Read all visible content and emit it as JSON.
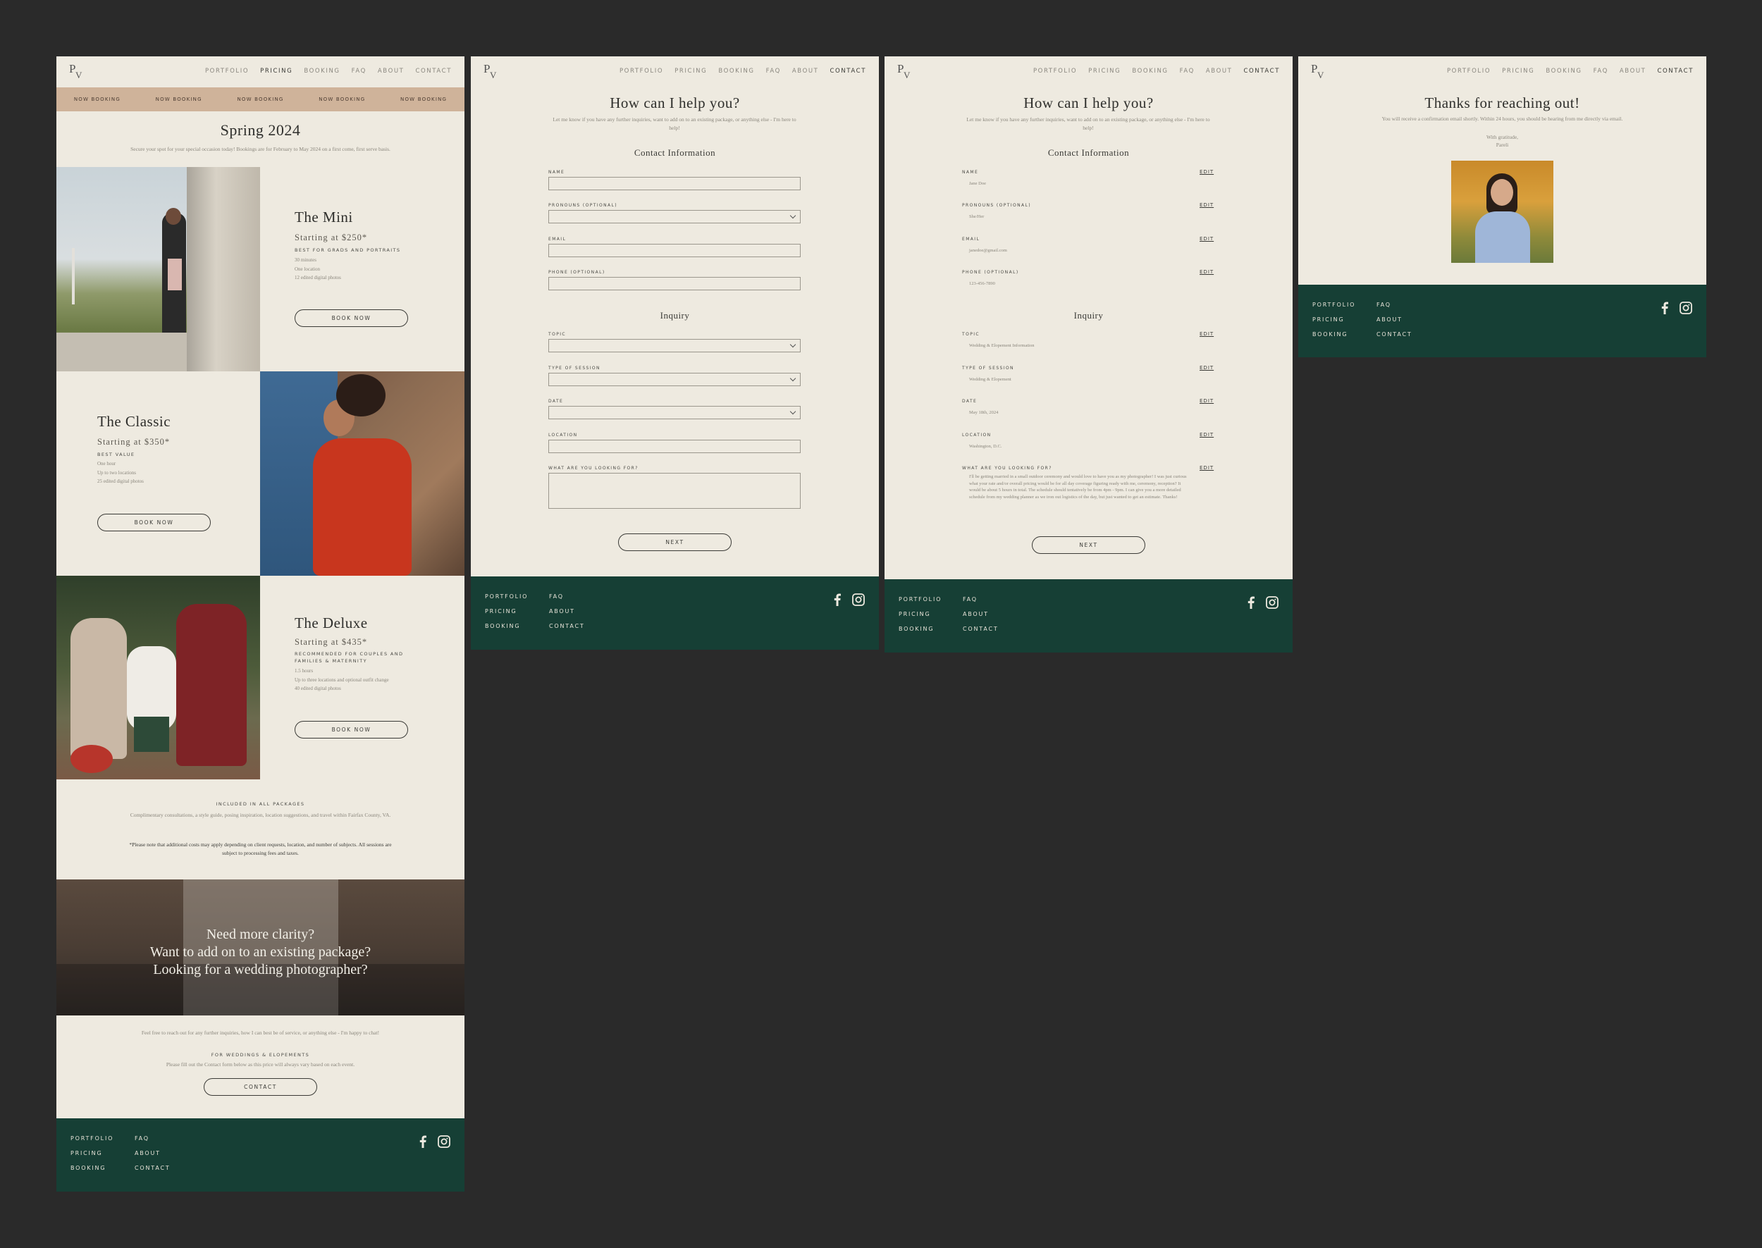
{
  "nav": {
    "logo_top": "P",
    "logo_bottom": "V",
    "links": [
      "PORTFOLIO",
      "PRICING",
      "BOOKING",
      "FAQ",
      "ABOUT",
      "CONTACT"
    ]
  },
  "pricing": {
    "ticker": [
      "NOW BOOKING",
      "NOW BOOKING",
      "NOW BOOKING",
      "NOW BOOKING",
      "NOW BOOKING"
    ],
    "title": "Spring 2024",
    "subtitle": "Secure your spot for your special occasion today! Bookings are for February to May 2024 on a first come, first serve basis.",
    "packages": [
      {
        "name": "The Mini",
        "price": "Starting at $250*",
        "tag": "BEST FOR GRADS AND PORTRAITS",
        "items": [
          "30 minutes",
          "One location",
          "12 edited digital photos"
        ],
        "button": "BOOK NOW"
      },
      {
        "name": "The Classic",
        "price": "Starting at $350*",
        "tag": "BEST VALUE",
        "items": [
          "One hour",
          "Up to two locations",
          "25 edited digital photos"
        ],
        "button": "BOOK NOW"
      },
      {
        "name": "The Deluxe",
        "price": "Starting at $435*",
        "tag": "RECOMMENDED FOR COUPLES AND FAMILIES & MATERNITY",
        "items": [
          "1.5 hours",
          "Up to three locations and optional outfit change",
          "40 edited digital photos"
        ],
        "button": "BOOK NOW"
      }
    ],
    "included_label": "INCLUDED IN ALL PACKAGES",
    "included_text": "Complimentary consultations, a style guide, posing inspiration, location suggestions, and travel within Fairfax County, VA.",
    "disclaimer": "*Please note that additional costs may apply depending on client requests, location, and number of subjects. All sessions are subject to processing fees and taxes.",
    "banner": [
      "Need more clarity?",
      "Want to add on to an existing package?",
      "Looking for a wedding photographer?"
    ],
    "reach_text": "Feel free to reach out for any further inquiries, how I can best be of service, or anything else - I'm happy to chat!",
    "weddings_label": "FOR WEDDINGS & ELOPEMENTS",
    "weddings_text": "Please fill out the Contact form below as this price will always vary based on each event.",
    "contact_button": "CONTACT"
  },
  "contact": {
    "title": "How can I help you?",
    "subtitle": "Let me know if you have any further inquiries, want to add on to an existing package, or anything else - I'm here to help!",
    "section1": "Contact Information",
    "section2": "Inquiry",
    "fields": [
      "NAME",
      "PRONOUNS (OPTIONAL)",
      "EMAIL",
      "PHONE (OPTIONAL)"
    ],
    "inquiry_fields": [
      "TOPIC",
      "TYPE OF SESSION",
      "DATE",
      "LOCATION",
      "WHAT ARE YOU LOOKING FOR?"
    ],
    "next_button": "NEXT"
  },
  "review": {
    "edit_label": "EDIT",
    "values": [
      "Jane Doe",
      "She/Her",
      "janedoe@gmail.com",
      "123-456-7890"
    ],
    "inquiry_values": [
      "Wedding & Elopement Information",
      "Wedding & Elopement",
      "May 18th, 2024",
      "Washington, D.C."
    ],
    "message": "I'll be getting married in a small outdoor ceremony and would love to have you as my photographer! I was just curious what your rate and/or overall pricing would be for all day coverage figuring ready with me, ceremony, reception? It would be about 5 hours in total. The schedule should tentatively be from 4pm - 9pm. I can give you a more detailed schedule from my wedding planner as we iron out logistics of the day, but just wanted to get an estimate. Thanks!"
  },
  "thanks": {
    "title": "Thanks for reaching out!",
    "subtitle": "You will receive a confirmation email shortly. Within 24 hours, you should be hearing from me directly via email.",
    "signoff1": "With gratitude,",
    "signoff2": "Pareli"
  },
  "footer": {
    "col1": [
      "PORTFOLIO",
      "PRICING",
      "BOOKING"
    ],
    "col2": [
      "FAQ",
      "ABOUT",
      "CONTACT"
    ],
    "icons": [
      "facebook-icon",
      "instagram-icon"
    ]
  },
  "colors": {
    "background": "#2a2a2a",
    "page": "#eeeae0",
    "footer": "#163f35",
    "ticker": "#cfb39a"
  }
}
